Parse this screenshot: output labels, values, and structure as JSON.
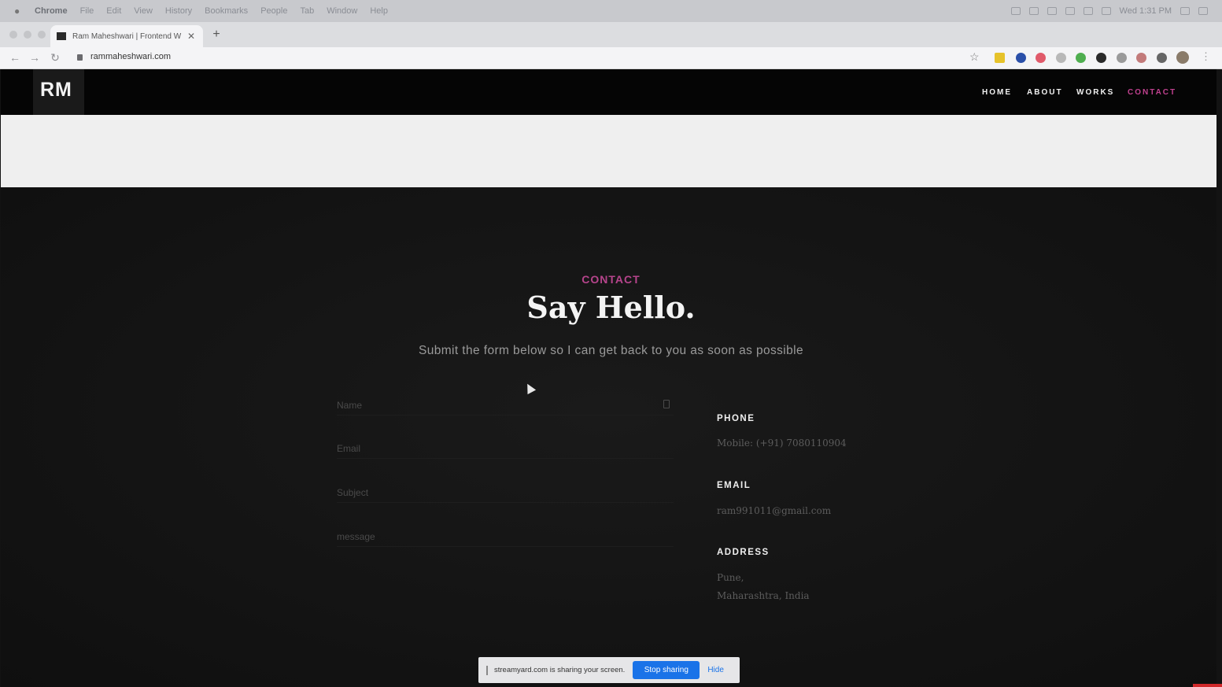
{
  "menubar": {
    "app": "Chrome",
    "items": [
      "File",
      "Edit",
      "View",
      "History",
      "Bookmarks",
      "People",
      "Tab",
      "Window",
      "Help"
    ],
    "clock": "Wed 1:31 PM"
  },
  "browser": {
    "tab_title": "Ram Maheshwari | Frontend W",
    "url": "rammaheshwari.com"
  },
  "site": {
    "logo": "RM",
    "nav": [
      "HOME",
      "ABOUT",
      "WORKS",
      "CONTACT"
    ],
    "active_nav": "CONTACT",
    "accent_color": "#b6448c"
  },
  "contact": {
    "eyebrow": "CONTACT",
    "headline": "Say Hello.",
    "subline": "Submit the form below so I can get back to you as soon as possible",
    "form": {
      "name_placeholder": "Name",
      "email_placeholder": "Email",
      "subject_placeholder": "Subject",
      "message_placeholder": "message"
    },
    "info": {
      "phone_label": "PHONE",
      "phone_value": "Mobile: (+91) 7080110904",
      "email_label": "EMAIL",
      "email_value": "ram991011@gmail.com",
      "address_label": "ADDRESS",
      "address_line1": "Pune,",
      "address_line2": "Maharashtra, India"
    }
  },
  "share_bar": {
    "message": "streamyard.com is sharing your screen.",
    "stop_label": "Stop sharing",
    "hide_label": "Hide"
  }
}
